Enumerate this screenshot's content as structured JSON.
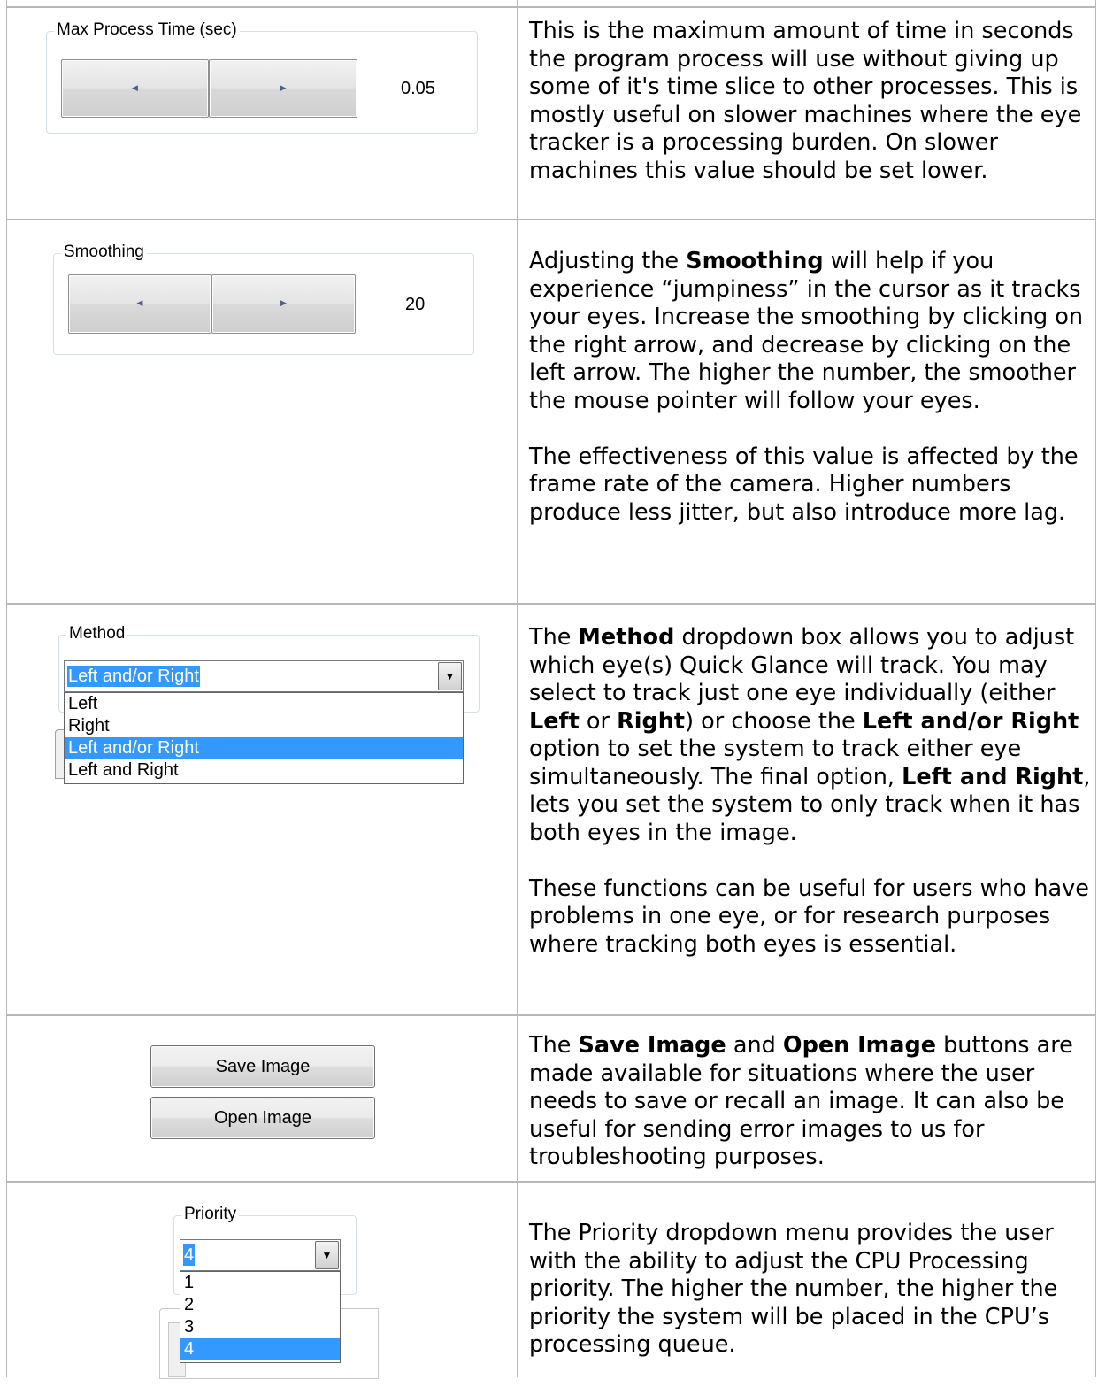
{
  "rows": [
    {
      "widget": {
        "group_label": "Max Process Time (sec)",
        "left_arrow": "left-arrow-icon",
        "right_arrow": "right-arrow-icon",
        "value": "0.05"
      },
      "desc": "This is the maximum amount of time in seconds the program process will use without giving up some of it's time slice to other processes.  This is mostly useful on slower machines where the eye tracker is a processing burden.  On slower machines this value should be set lower."
    },
    {
      "widget": {
        "group_label": "Smoothing",
        "left_arrow": "left-arrow-icon",
        "right_arrow": "right-arrow-icon",
        "value": "20"
      },
      "desc_1_a": "Adjusting the ",
      "desc_1_b": "Smoothing",
      "desc_1_c": " will help if you experience “jumpiness” in the cursor as it tracks your eyes.  Increase the smoothing by clicking on the right arrow, and decrease by clicking on the left arrow.  The higher the number, the smoother the mouse pointer will follow your eyes.",
      "desc_2": "The effectiveness of this value is affected by the frame rate of the camera.  Higher numbers produce less jitter, but also introduce more lag."
    },
    {
      "widget": {
        "group_label": "Method",
        "selected": "Left and/or Right",
        "options": [
          "Left",
          "Right",
          "Left and/or Right",
          "Left and Right"
        ],
        "dropdown_icon": "chevron-down-icon"
      },
      "d1": "The ",
      "d2": "Method",
      "d3": " dropdown box allows you to adjust which eye(s) Quick Glance will track.  You may select to track just one eye individually (either ",
      "d4": "Left",
      "d5": " or ",
      "d6": "Right",
      "d7": ") or choose the ",
      "d8": "Left and/or Right",
      "d9": " option to set the system to track either eye simultaneously.  The final option, ",
      "d10": "Left and Right",
      "d11": ", lets you set the system to only track when it has both eyes in the image.",
      "desc_2": "These functions can be useful for users who have problems in one eye, or for research purposes where tracking both eyes is essential."
    },
    {
      "widget": {
        "save_label": "Save Image",
        "open_label": "Open Image"
      },
      "d1": "The ",
      "d2": "Save Image",
      "d3": " and ",
      "d4": "Open Image",
      "d5": " buttons are made available for situations where the user needs to save or recall an image.  It can also be useful for sending error images to us for troubleshooting purposes."
    },
    {
      "widget": {
        "group_label": "Priority",
        "selected": "4",
        "options": [
          "1",
          "2",
          "3",
          "4"
        ],
        "dropdown_icon": "chevron-down-icon"
      },
      "desc": "The Priority dropdown menu provides the user with the ability to adjust the CPU Processing priority.  The higher the number, the higher the priority the system will be placed in the CPU’s processing queue."
    }
  ]
}
